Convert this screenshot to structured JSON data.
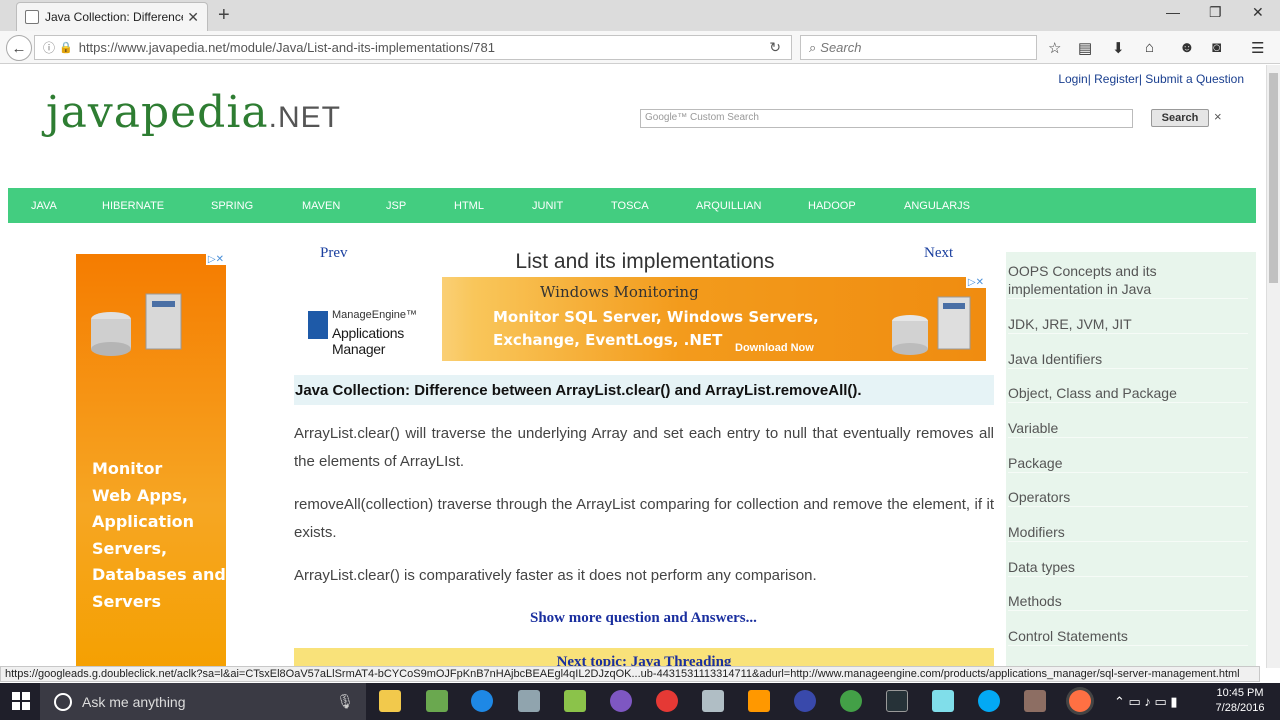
{
  "browser": {
    "tab_title": "Java Collection: Difference...",
    "url": "https://www.javapedia.net/module/Java/List-and-its-implementations/781",
    "search_placeholder": "Search",
    "status_url": "https://googleads.g.doubleclick.net/aclk?sa=l&ai=CTsxEl8OaV57aLlSrmAT4-bCYCoS9mOJFpKnB7nHAjbcBEAEgl4qIL2DJzqOK...ub-4431531113314711&adurl=http://www.manageengine.com/products/applications_manager/sql-server-management.html"
  },
  "site": {
    "top_links": "Login| Register| Submit a Question",
    "logo_main": "javapedia",
    "logo_suffix": ".NET",
    "google_search_placeholder": "Google™ Custom Search",
    "search_button": "Search",
    "close_glyph": "×",
    "menu": [
      "JAVA",
      "HIBERNATE",
      "SPRING",
      "MAVEN",
      "JSP",
      "HTML",
      "JUNIT",
      "TOSCA",
      "ARQUILLIAN",
      "HADOOP",
      "ANGULARJS"
    ]
  },
  "left_ad": {
    "text": "Monitor\nWeb Apps,\nApplication\nServers,\nDatabases and\nServers"
  },
  "main": {
    "prev": "Prev",
    "next": "Next",
    "title": "List and its implementations",
    "banner": {
      "brand": "ManageEngine™",
      "product": "Applications Manager",
      "heading": "Windows Monitoring",
      "line1": "Monitor SQL Server, Windows Servers,",
      "line2": "Exchange, EventLogs, .NET",
      "cta": "Download Now"
    },
    "question": "Java Collection: Difference between ArrayList.clear() and ArrayList.removeAll().",
    "paragraphs": [
      "ArrayList.clear() will traverse the underlying Array and set each entry to null that eventually removes all the elements of ArrayLIst.",
      "removeAll(collection) traverse through the ArrayList comparing for collection and remove the element, if it exists.",
      "ArrayList.clear() is comparatively faster as it does not perform any comparison."
    ],
    "show_more": "Show more question and Answers...",
    "next_topic": "Next topic: Java Threading"
  },
  "sidebar": {
    "items": [
      "OOPS Concepts and its implementation in Java",
      "JDK, JRE, JVM, JIT",
      "Java Identifiers",
      "Object, Class and Package",
      "Variable",
      "Package",
      "Operators",
      "Modifiers",
      "Data types",
      "Methods",
      "Control Statements"
    ]
  },
  "taskbar": {
    "cortana": "Ask me anything",
    "time": "10:45 PM",
    "date": "7/28/2016"
  },
  "colors": {
    "menu_green": "#43cd80",
    "link_blue": "#1a3f9f",
    "sidebar_bg": "#e8f5ec"
  }
}
